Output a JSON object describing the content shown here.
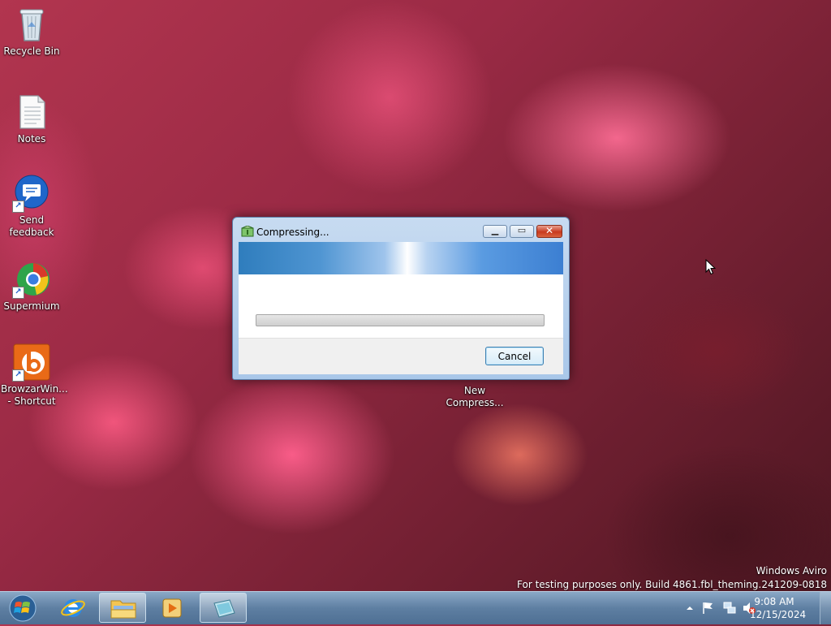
{
  "desktop": {
    "icons": [
      {
        "label": "Recycle Bin"
      },
      {
        "label": "Notes"
      },
      {
        "label": "Send feedback"
      },
      {
        "label": "Supermium"
      },
      {
        "label": "BrowzarWin... - Shortcut"
      },
      {
        "label": "New Compress..."
      }
    ]
  },
  "dialog": {
    "title": "Compressing...",
    "progress_fraction": 0.0,
    "cancel_label": "Cancel"
  },
  "watermark": {
    "line1": "Windows Aviro",
    "line2": "For testing purposes only. Build 4861.fbl_theming.241209-0818"
  },
  "taskbar": {
    "items": [
      {
        "icon": "start-orb-icon"
      },
      {
        "icon": "internet-explorer-icon"
      },
      {
        "icon": "file-explorer-icon"
      },
      {
        "icon": "media-player-icon"
      },
      {
        "icon": "compression-app-icon"
      }
    ],
    "clock": {
      "time": "9:08 AM",
      "date": "12/15/2024"
    }
  },
  "colors": {
    "taskbar": "#5e7fa2",
    "dialog_frame": "#a9c7e9",
    "banner_accent": "#3c7fd2",
    "close_button": "#c8391e"
  }
}
